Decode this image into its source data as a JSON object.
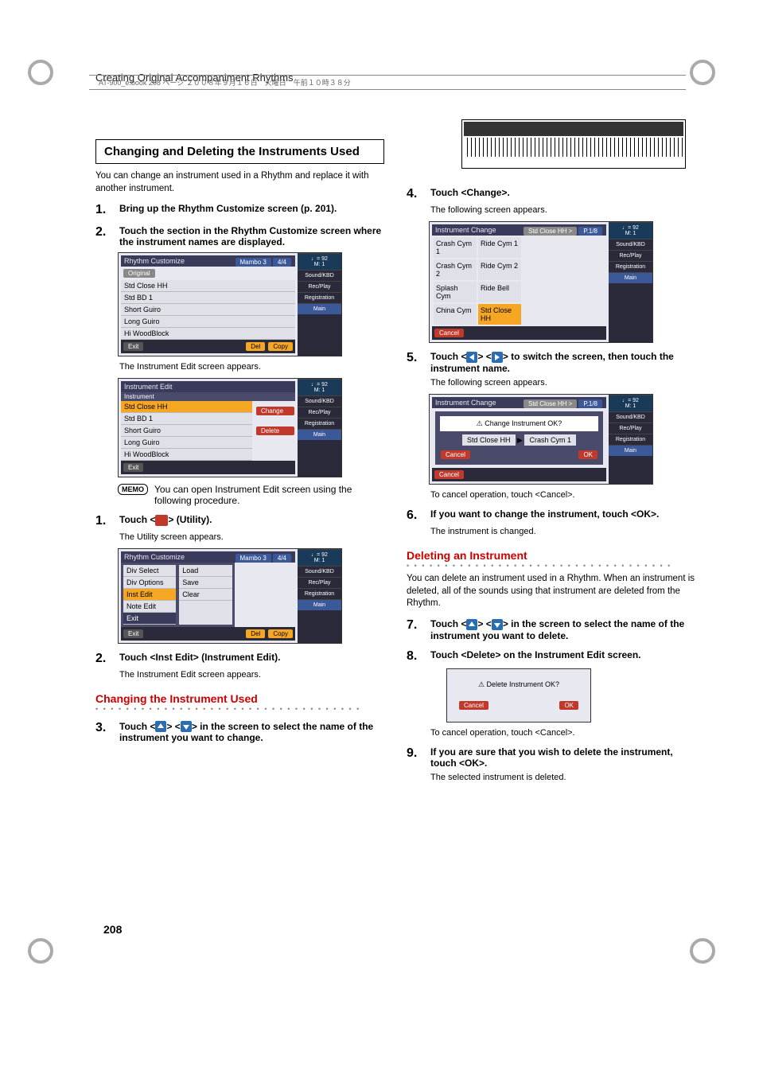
{
  "header_band": "AT-900_e.book  208 ページ  ２００８年９月１６日　火曜日　午前１０時３８分",
  "running_head": "Creating Original Accompaniment Rhythms",
  "page_number": "208",
  "left": {
    "box_heading": "Changing and Deleting the Instruments Used",
    "intro": "You can change an instrument used in a Rhythm and replace it with another instrument.",
    "step1": "Bring up the Rhythm Customize screen (p. 201).",
    "step2": "Touch the section in the Rhythm Customize screen where the instrument names are displayed.",
    "caption_after_s2": "The Instrument Edit screen appears.",
    "memo_text": "You can open Instrument Edit screen using the following procedure.",
    "memo_label": "MEMO",
    "memo_step1_pre": "Touch <",
    "memo_step1_post": "> (Utility).",
    "memo_step1_caption": "The Utility screen appears.",
    "memo_step2": "Touch <Inst Edit> (Instrument Edit).",
    "memo_step2_caption": "The Instrument Edit screen appears.",
    "subsection": "Changing the Instrument Used",
    "step3_pre": "Touch <",
    "step3_mid": "> <",
    "step3_post": "> in the screen to select the name of the instrument you want to change."
  },
  "right": {
    "step4": "Touch <Change>.",
    "step4_caption": "The following screen appears.",
    "step5_pre": "Touch <",
    "step5_mid": "> <",
    "step5_post": "> to switch the screen, then touch the instrument name.",
    "step5_caption": "The following screen appears.",
    "cancel_note": "To cancel operation, touch <Cancel>.",
    "step6": "If you want to change the instrument, touch <OK>.",
    "step6_caption": "The instrument is changed.",
    "subsection": "Deleting an Instrument",
    "sub_intro": "You can delete an instrument used in a Rhythm. When an instrument is deleted, all of the sounds using that instrument are deleted from the Rhythm.",
    "step7_pre": "Touch <",
    "step7_mid": "> <",
    "step7_post": "> in the screen to select the name of the instrument you want to delete.",
    "step8": "Touch <Delete> on the Instrument Edit screen.",
    "step9": "If you are sure that you wish to delete the instrument, touch <OK>.",
    "step9_caption": "The selected instrument is deleted."
  },
  "scr": {
    "tempo": "92",
    "measure": "M:    1",
    "side": [
      "Sound/KBD",
      "Rec/Play",
      "Registration",
      "Main"
    ],
    "rc_title": "Rhythm Customize",
    "rc_tab1": "Mambo 3",
    "rc_tab2": "4/4",
    "rc_original": "Original",
    "rc_rows": [
      "Std Close HH",
      "Std BD 1",
      "Short Guiro",
      "Long Guiro",
      "Hi WoodBlock"
    ],
    "exit": "Exit",
    "del": "Del",
    "copy": "Copy",
    "ie_title": "Instrument Edit",
    "ie_sub": "Instrument",
    "ie_rows": [
      "Std Close HH",
      "Std BD 1",
      "Short Guiro",
      "Long Guiro",
      "Hi WoodBlock"
    ],
    "change": "Change",
    "delete": "Delete",
    "util_rows_l": [
      "Div Select",
      "Div Options",
      "Inst Edit",
      "Note Edit",
      "Exit"
    ],
    "util_rows_r": [
      "Load",
      "Save",
      "Clear"
    ],
    "ic_title": "Instrument Change",
    "ic_badge": "Std Close HH >",
    "ic_pg": "P.1/8",
    "ic_cells": [
      "Crash Cym 1",
      "Ride Cym 1",
      "Crash Cym 2",
      "Ride Cym 2",
      "Splash Cym",
      "Ride Bell",
      "China Cym",
      "Std Close HH"
    ],
    "cancel": "Cancel",
    "ok": "OK",
    "confirm_msg": "Change Instrument OK?",
    "confirm_from": "Std Close HH",
    "confirm_to": "Crash Cym 1",
    "del_msg": "Delete Instrument OK?"
  }
}
